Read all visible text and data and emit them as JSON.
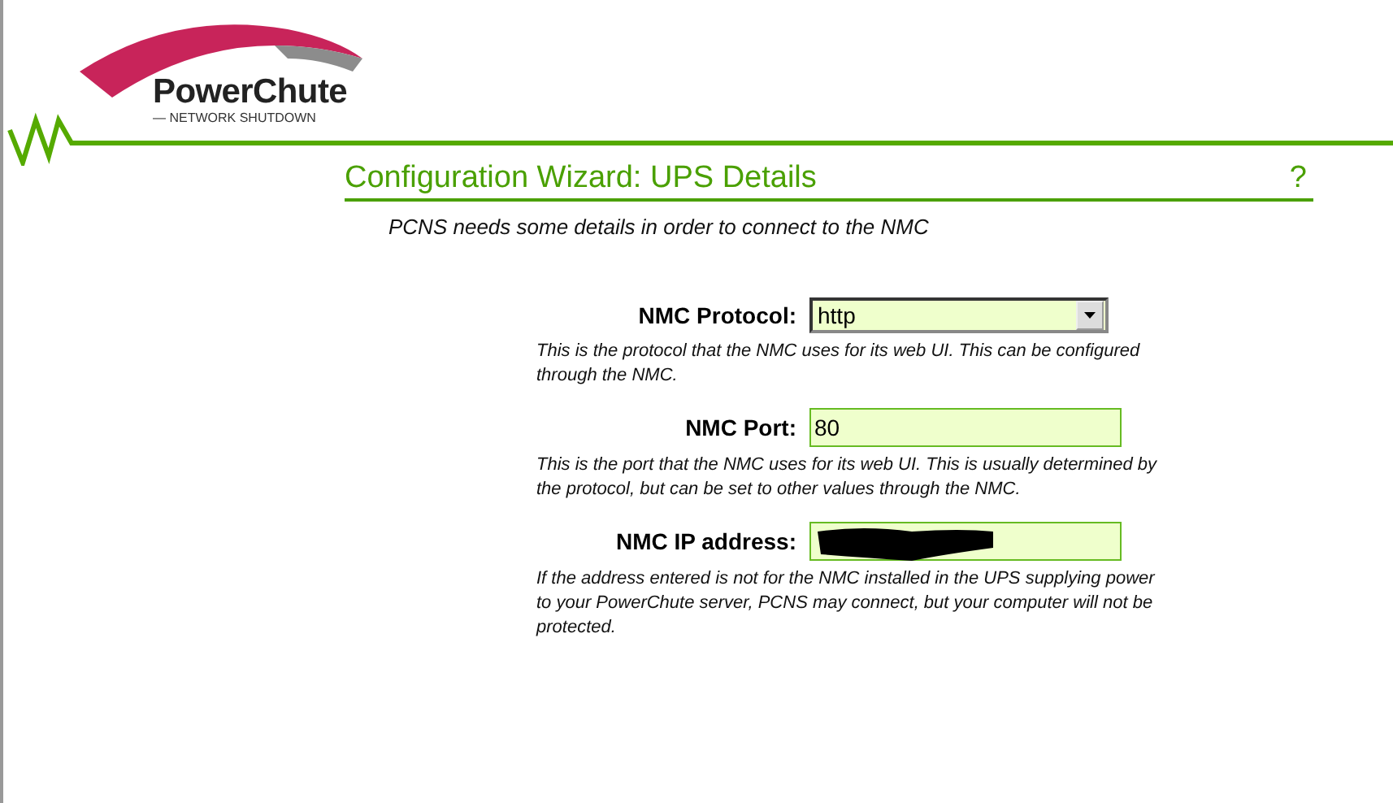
{
  "logo": {
    "name": "PowerChute",
    "tagline": "— NETWORK SHUTDOWN"
  },
  "heading": {
    "title": "Configuration Wizard: UPS Details",
    "help": "?"
  },
  "intro": "PCNS needs some details in order to connect to the NMC",
  "fields": [
    {
      "kind": "dropdown",
      "label": "NMC Protocol:",
      "value": "http",
      "help": "This is the protocol that the NMC uses for its web UI. This can be configured through the NMC."
    },
    {
      "kind": "text",
      "label": "NMC Port:",
      "value": "80",
      "help": "This is the port that the NMC uses for its web UI. This is usually determined by the protocol, but can be set to other values through the NMC."
    },
    {
      "kind": "text",
      "label": "NMC IP address:",
      "redacted": true,
      "help": "If the address entered is not for the NMC installed in the UPS supplying power to your PowerChute server, PCNS may connect, but your computer will not be protected."
    }
  ]
}
